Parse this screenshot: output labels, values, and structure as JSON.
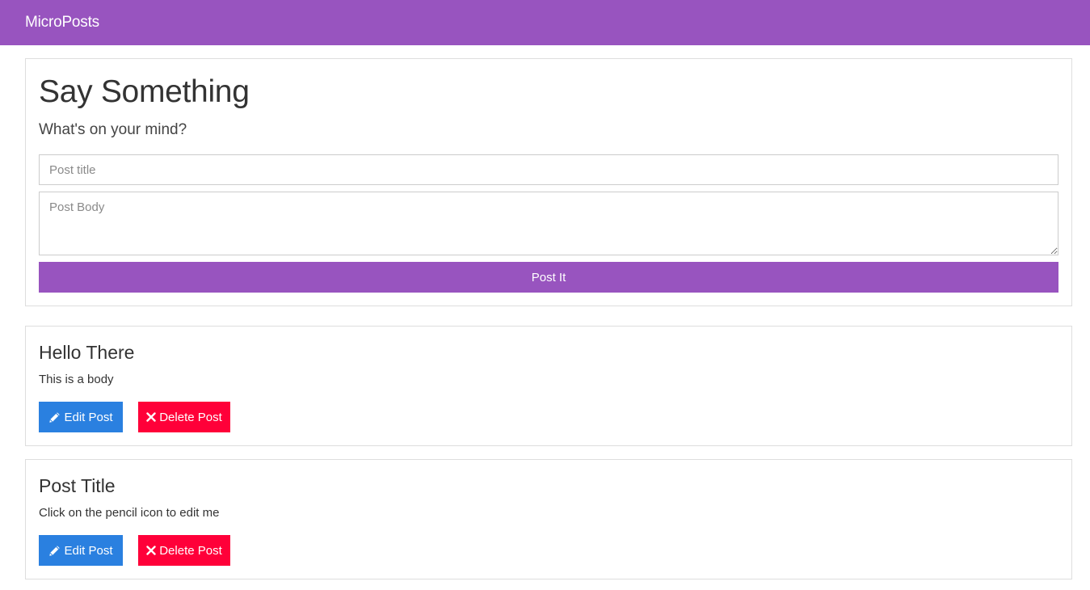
{
  "navbar": {
    "brand": "MicroPosts",
    "color": "#9854bf"
  },
  "form": {
    "title": "Say Something",
    "lead": "What's on your mind?",
    "title_placeholder": "Post title",
    "title_value": "",
    "body_placeholder": "Post Body",
    "body_value": "",
    "submit_label": "Post It"
  },
  "posts": [
    {
      "title": "Hello There",
      "body": "This is a body",
      "edit_label": "Edit Post",
      "edit_icon": "pencil-icon",
      "delete_label": "Delete Post",
      "delete_icon": "times-icon"
    },
    {
      "title": "Post Title",
      "body": "Click on the pencil icon to edit me",
      "edit_label": "Edit Post",
      "edit_icon": "pencil-icon",
      "delete_label": "Delete Post",
      "delete_icon": "times-icon"
    }
  ],
  "colors": {
    "primary": "#9854bf",
    "edit": "#2a80e0",
    "delete": "#ff0039"
  }
}
